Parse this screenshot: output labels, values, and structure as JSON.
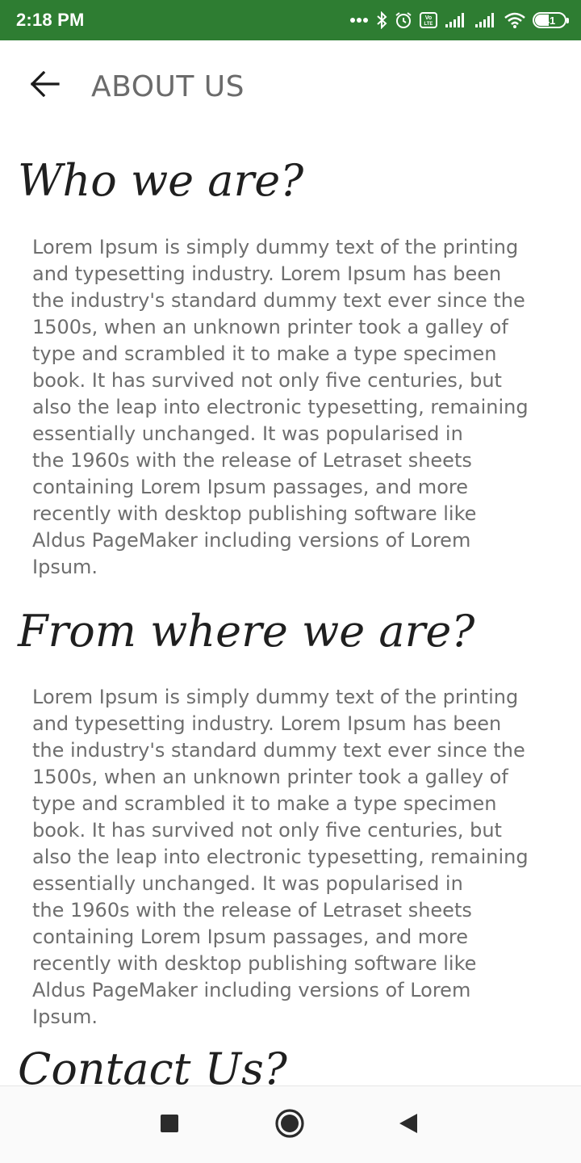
{
  "status_bar": {
    "time": "2:18 PM",
    "battery_level": "41",
    "icons": [
      "more-dots-icon",
      "bluetooth-icon",
      "alarm-icon",
      "volte-icon",
      "signal-icon",
      "signal-icon",
      "wifi-icon",
      "battery-icon"
    ]
  },
  "app_bar": {
    "title": "ABOUT US",
    "back_icon": "arrow-left-icon"
  },
  "sections": [
    {
      "heading": "Who we are?",
      "body": "Lorem Ipsum is simply dummy text of the printing\nand typesetting industry. Lorem Ipsum has been\nthe industry's standard dummy text ever since the\n1500s, when an unknown printer took a galley of\ntype and scrambled it to make a type specimen\nbook. It has survived not only five centuries, but\nalso the leap into electronic typesetting, remaining\nessentially unchanged. It was popularised in\nthe 1960s with the release of Letraset sheets\ncontaining Lorem Ipsum passages, and more\nrecently with desktop publishing software like\nAldus PageMaker including versions of Lorem\nIpsum."
    },
    {
      "heading": "From where we are?",
      "body": "Lorem Ipsum is simply dummy text of the printing\nand typesetting industry. Lorem Ipsum has been\nthe industry's standard dummy text ever since the\n1500s, when an unknown printer took a galley of\ntype and scrambled it to make a type specimen\nbook. It has survived not only five centuries, but\nalso the leap into electronic typesetting, remaining\nessentially unchanged. It was popularised in\nthe 1960s with the release of Letraset sheets\ncontaining Lorem Ipsum passages, and more\nrecently with desktop publishing software like\nAldus PageMaker including versions of Lorem\nIpsum."
    },
    {
      "heading": "Contact Us?"
    }
  ],
  "nav_bar": {
    "buttons": [
      "recents-square-icon",
      "home-circle-icon",
      "back-triangle-icon"
    ]
  },
  "colors": {
    "status_bar_bg": "#2e7d32",
    "title_text": "#6b6b6b",
    "heading_text": "#1f1f1f",
    "body_text": "#6e6e6e"
  }
}
